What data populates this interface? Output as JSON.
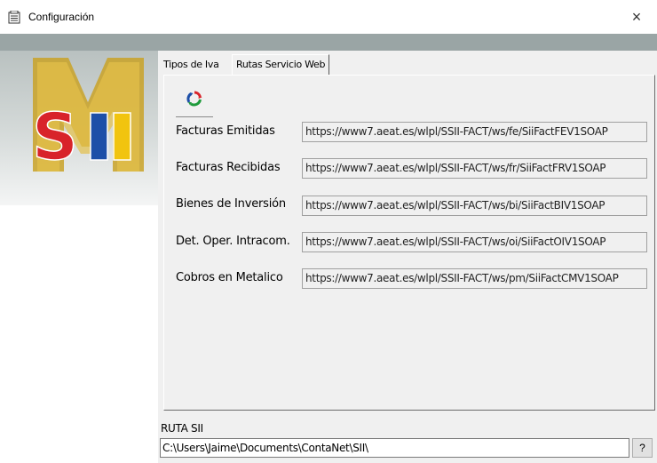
{
  "window": {
    "title": "Configuración",
    "close_glyph": "×"
  },
  "logo": {
    "text": "SII",
    "icon": "sii-logo"
  },
  "tabs": [
    {
      "label": "Tipos de Iva",
      "active": false
    },
    {
      "label": "Rutas Servicio Web",
      "active": true
    }
  ],
  "refresh_button": {
    "icon": "refresh-icon"
  },
  "routes": [
    {
      "label": "Facturas Emitidas",
      "url": "https://www7.aeat.es/wlpl/SSII-FACT/ws/fe/SiiFactFEV1SOAP"
    },
    {
      "label": "Facturas Recibidas",
      "url": "https://www7.aeat.es/wlpl/SSII-FACT/ws/fr/SiiFactFRV1SOAP"
    },
    {
      "label": "Bienes de Inversión",
      "url": "https://www7.aeat.es/wlpl/SSII-FACT/ws/bi/SiiFactBIV1SOAP"
    },
    {
      "label": "Det. Oper. Intracom.",
      "url": "https://www7.aeat.es/wlpl/SSII-FACT/ws/oi/SiiFactOIV1SOAP"
    },
    {
      "label": "Cobros en Metalico",
      "url": "https://www7.aeat.es/wlpl/SSII-FACT/ws/pm/SiiFactCMV1SOAP"
    }
  ],
  "ruta_sii": {
    "label": "RUTA SII",
    "value": "C:\\Users\\Jaime\\Documents\\ContaNet\\SII\\",
    "browse_label": "?"
  },
  "colors": {
    "band": "#9aa5a5",
    "dialog_bg": "#f0f0f0",
    "logo_red": "#d8232a",
    "logo_blue": "#1d4fa8",
    "logo_yellow": "#f1c40f",
    "logo_gold": "#c9a227"
  }
}
